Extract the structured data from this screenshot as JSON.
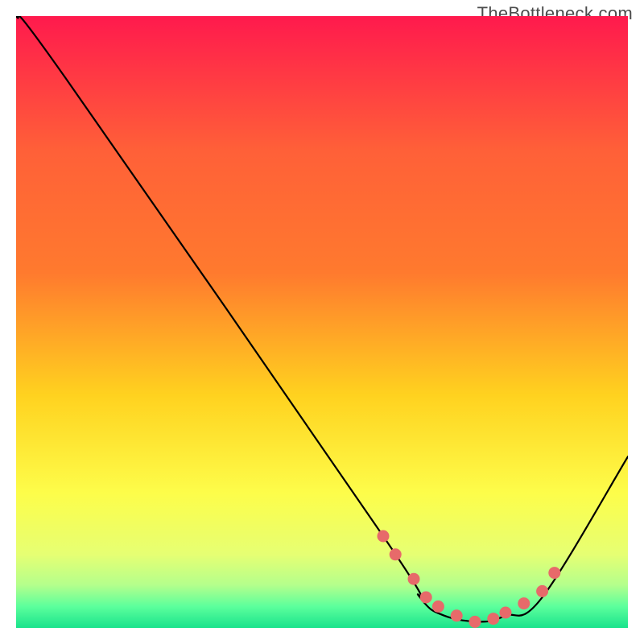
{
  "watermark": "TheBottleneck.com",
  "chart_data": {
    "type": "line",
    "title": "",
    "xlabel": "",
    "ylabel": "",
    "xlim": [
      0,
      100
    ],
    "ylim": [
      0,
      100
    ],
    "series": [
      {
        "name": "curve",
        "x": [
          0,
          8,
          60,
          66,
          70,
          76,
          80,
          86,
          100
        ],
        "y": [
          100,
          90,
          15,
          5,
          2,
          1,
          2,
          5,
          28
        ]
      }
    ],
    "marker_points": {
      "name": "markers",
      "x": [
        60,
        62,
        65,
        67,
        69,
        72,
        75,
        78,
        80,
        83,
        86,
        88
      ],
      "y": [
        15,
        12,
        8,
        5,
        3.5,
        2,
        1,
        1.5,
        2.5,
        4,
        6,
        9
      ]
    },
    "background_gradient": {
      "top": "#ff1a4d",
      "upper_mid": "#ff7a2e",
      "mid": "#ffd21f",
      "lower_mid": "#fdfd4a",
      "low": "#e6ff73",
      "base1": "#b4ff8c",
      "base2": "#5cff9c",
      "base3": "#19e38c"
    },
    "curve_color": "#000000",
    "marker_color": "#e76a6a"
  }
}
